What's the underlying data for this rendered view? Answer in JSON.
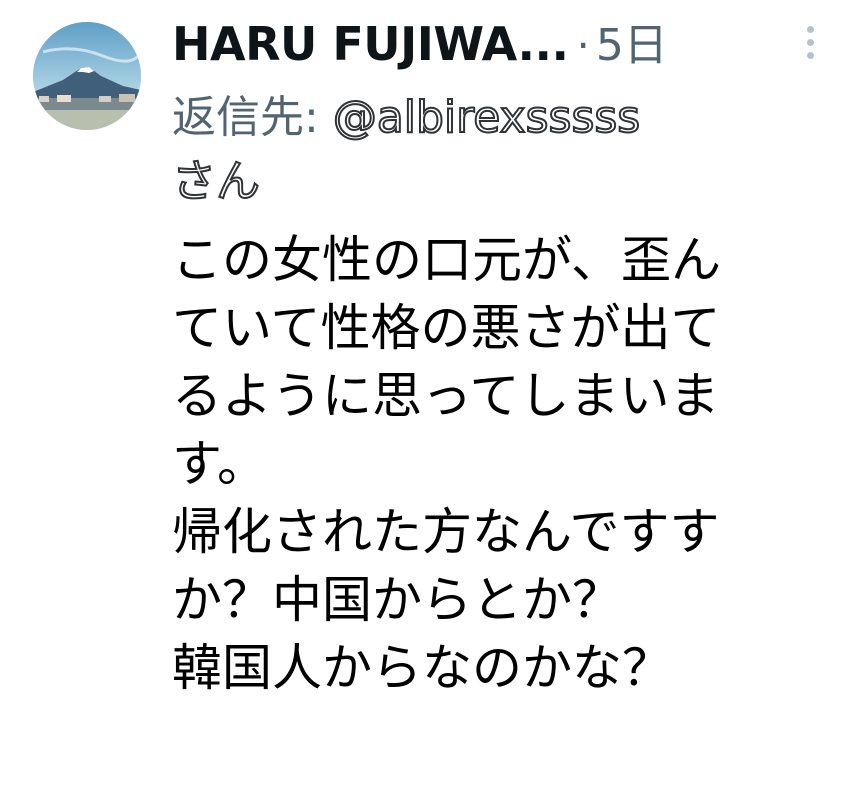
{
  "tweet": {
    "avatar_icon": "mount-fuji-avatar-icon",
    "author_name": "HARU FUJIWA...",
    "separator": "·",
    "time": "5日",
    "more_icon": "vertical-ellipsis-icon",
    "reply_prefix": "返信先: ",
    "reply_handle": "@albirexsssss",
    "reply_suffix": "さん",
    "text_lines": [
      "この女性の口元が、歪ん",
      "ていて性格の悪さが出て",
      "るように思ってしまいま",
      "す。",
      "帰化された方なんですす",
      "か？中国からとか？",
      "韓国人からなのかな？"
    ]
  },
  "colors": {
    "text": "#0f1419",
    "secondary": "#536471",
    "outline_text": "#2f3336",
    "more_dots": "#b8c1c9"
  }
}
